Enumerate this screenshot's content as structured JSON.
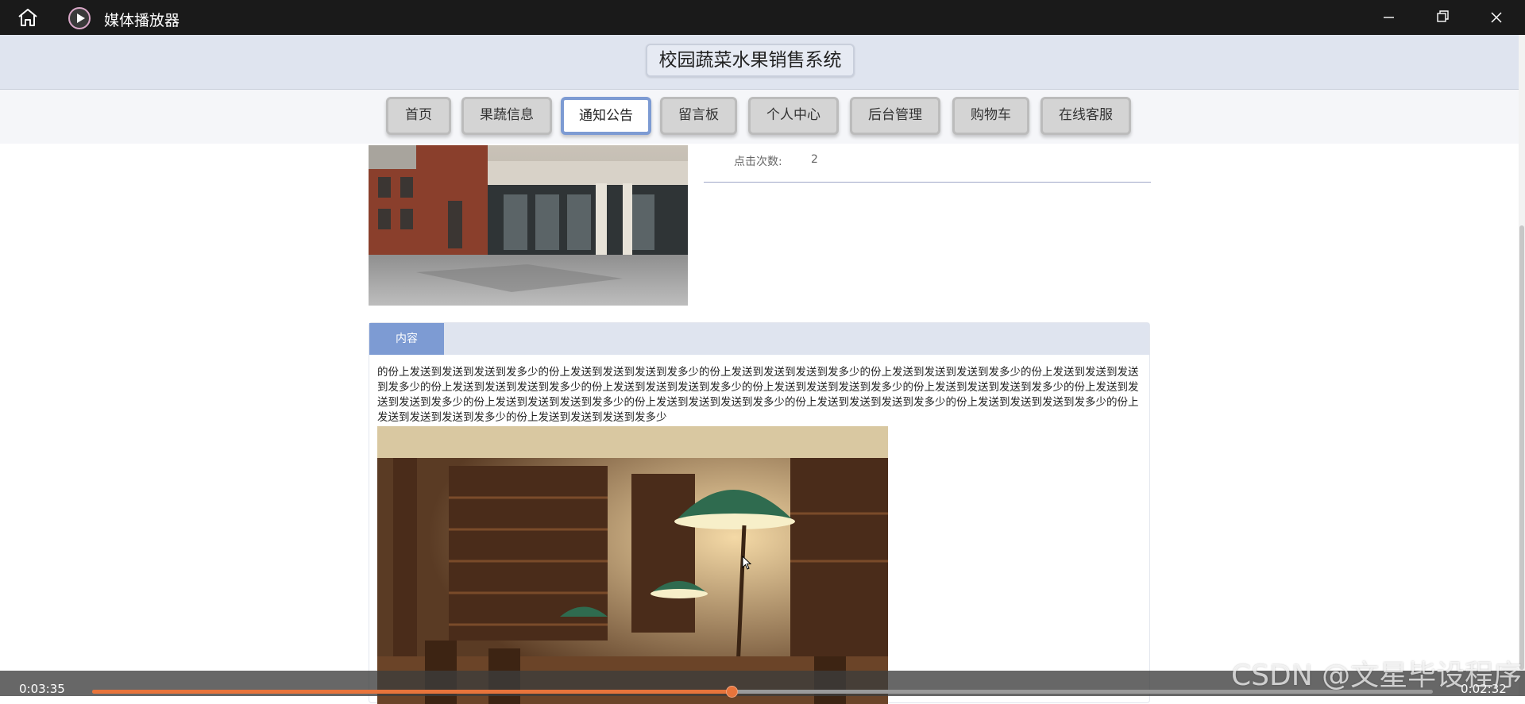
{
  "window": {
    "title": "媒体播放器",
    "icons": {
      "home": "home-icon",
      "app": "media-player-icon",
      "minimize": "minimize-icon",
      "maximize": "maximize-icon",
      "close": "close-icon"
    }
  },
  "site": {
    "title": "校园蔬菜水果销售系统"
  },
  "nav": {
    "items": [
      {
        "label": "首页",
        "active": false
      },
      {
        "label": "果蔬信息",
        "active": false
      },
      {
        "label": "通知公告",
        "active": true
      },
      {
        "label": "留言板",
        "active": false
      },
      {
        "label": "个人中心",
        "active": false
      },
      {
        "label": "后台管理",
        "active": false
      },
      {
        "label": "购物车",
        "active": false
      },
      {
        "label": "在线客服",
        "active": false
      }
    ]
  },
  "detail": {
    "clicks_label": "点击次数:",
    "clicks_value": "2"
  },
  "content": {
    "tab_label": "内容",
    "text": "的份上发送到发送到发送到发多少的份上发送到发送到发送到发多少的份上发送到发送到发送到发多少的份上发送到发送到发送到发多少的份上发送到发送到发送到发多少的份上发送到发送到发送到发多少的份上发送到发送到发送到发多少的份上发送到发送到发送到发多少的份上发送到发送到发送到发多少的份上发送到发送到发送到发多少的份上发送到发送到发送到发多少的份上发送到发送到发送到发多少的份上发送到发送到发送到发多少的份上发送到发送到发送到发多少的份上发送到发送到发送到发多少的份上发送到发送到发送到发多少"
  },
  "player": {
    "current_time": "0:03:35",
    "remaining_time": "0:02:32",
    "progress": 0.477
  },
  "watermark": "CSDN @文星毕设程序",
  "colors": {
    "accent": "#7d9bd3",
    "header_bg": "#dfe4ef",
    "progress": "#e8743b"
  }
}
